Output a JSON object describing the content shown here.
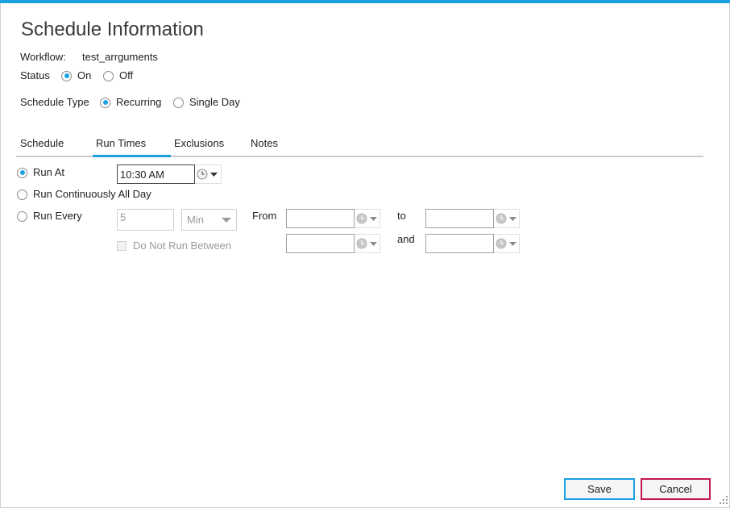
{
  "dialog": {
    "title": "Schedule Information"
  },
  "colors": {
    "accent": "#1ba1e2",
    "cancel_border": "#c4174f"
  },
  "icons": {
    "time_picker": "clock-icon",
    "dropdown": "chevron-down-icon",
    "resize_grip": "resize-grip-icon"
  },
  "workflow": {
    "label": "Workflow:",
    "name": "test_arrguments"
  },
  "status": {
    "label": "Status",
    "on": {
      "label": "On",
      "selected": true
    },
    "off": {
      "label": "Off",
      "selected": false
    }
  },
  "schedule_type": {
    "label": "Schedule Type",
    "recurring": {
      "label": "Recurring",
      "selected": true
    },
    "single_day": {
      "label": "Single Day",
      "selected": false
    }
  },
  "tabs": [
    {
      "label": "Schedule",
      "active": false
    },
    {
      "label": "Run Times",
      "active": true
    },
    {
      "label": "Exclusions",
      "active": false
    },
    {
      "label": "Notes",
      "active": false
    }
  ],
  "run_times": {
    "run_at": {
      "label": "Run At",
      "selected": true,
      "time": "10:30 AM"
    },
    "run_continuously": {
      "label": "Run Continuously All Day",
      "selected": false
    },
    "run_every": {
      "label": "Run Every",
      "selected": false,
      "disabled": true,
      "interval": "5",
      "unit": "Min",
      "from_label": "From",
      "to_label": "to"
    },
    "do_not_run_between": {
      "label": "Do Not Run Between",
      "checked": false,
      "disabled": true,
      "and_label": "and"
    }
  },
  "footer": {
    "save_label": "Save",
    "cancel_label": "Cancel"
  }
}
